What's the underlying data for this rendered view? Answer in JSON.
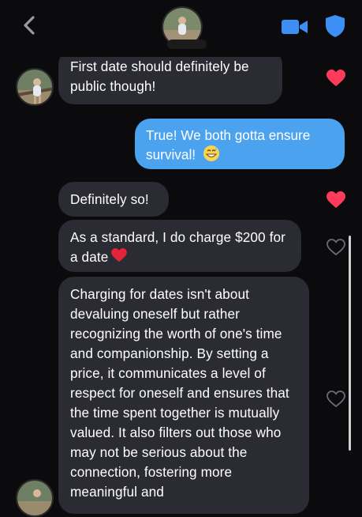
{
  "header": {
    "back_icon": "chevron-left-icon",
    "video_icon": "video-camera-icon",
    "safety_icon": "shield-icon",
    "accent": "#3b8ff5"
  },
  "messages": [
    {
      "from": "them",
      "text": "First date should definitely be public though!",
      "liked": true
    },
    {
      "from": "me",
      "text": "True! We both gotta ensure survival!",
      "emoji": "😅"
    },
    {
      "from": "them",
      "text": "Definitely so!",
      "liked": true
    },
    {
      "from": "them",
      "text": "As a standard, I do charge $200 for a date",
      "emoji": "❤️",
      "liked": false
    },
    {
      "from": "them",
      "text": "Charging for dates isn't about devaluing oneself but rather recognizing the worth of one's time and companionship. By setting a price, it communicates a level of respect for oneself and ensures that the time spent together is mutually valued. It also filters out those who may not be serious about the connection, fostering more meaningful and",
      "liked": false
    }
  ],
  "colors": {
    "background": "#0b0b0d",
    "incoming_bubble": "#2b2b33",
    "outgoing_bubble": "#4ba3f0",
    "heart_liked": "#ff3b5c",
    "heart_empty": "#6b6b72"
  }
}
